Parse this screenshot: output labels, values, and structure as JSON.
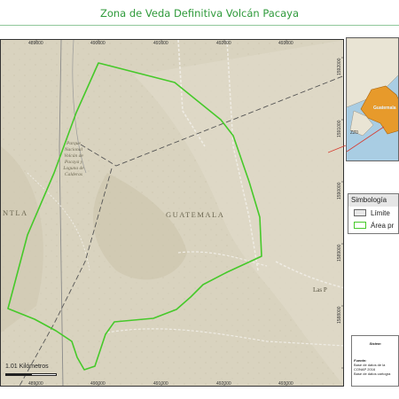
{
  "title": "Zona de Veda Definitiva Volcán Pacaya",
  "map": {
    "x_ticks": [
      "489000",
      "490000",
      "491000",
      "492000",
      "493000"
    ],
    "y_ticks": [
      "1592000",
      "1591000",
      "1590000",
      "1589000",
      "1588000"
    ],
    "places": {
      "left_town": "NTLA",
      "country": "GUATEMALA",
      "park": [
        "Parque",
        "Nacional",
        "Volcán de",
        "Pacaya y",
        "Laguna de",
        "Calderas"
      ],
      "town": "Las P"
    },
    "scale_label": "1.01 Kilómetros",
    "colors": {
      "protected_area": "#46c92a",
      "terrain": "#d8d1bd"
    }
  },
  "inset": {
    "label": "Guatemala",
    "small": "ZZ0"
  },
  "legend": {
    "title": "Simbología",
    "items": [
      {
        "label": "Límite",
        "symbol": "grey-box"
      },
      {
        "label": "Área pr",
        "symbol": "green-outline"
      }
    ]
  },
  "source": {
    "system": "Sistem",
    "fuente": "Fuente:",
    "lines": [
      "Base de datos de la",
      "CONAP 2016",
      "Base de datos cartogra"
    ]
  }
}
